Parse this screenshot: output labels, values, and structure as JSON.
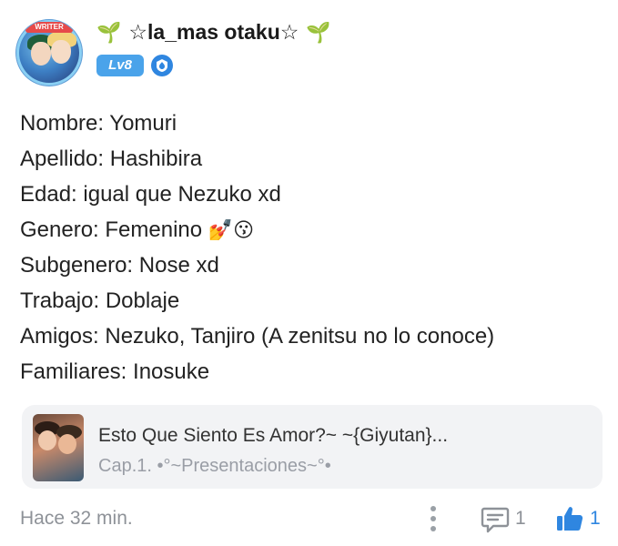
{
  "author": {
    "avatar_badge": "WRITER",
    "username": "☆la_mas otaku☆",
    "sprout_left": "🌱",
    "sprout_right": "🌱",
    "level": "Lv8",
    "level_color": "#4aa3ea",
    "leader_icon": "leader-shield-icon"
  },
  "post": {
    "lines": [
      "Nombre: Yomuri",
      "Apellido: Hashibira",
      "Edad: igual que Nezuko xd",
      "Genero: Femenino",
      "Subgenero: Nose xd",
      "Trabajo: Doblaje",
      "Amigos: Nezuko, Tanjiro (A zenitsu no lo conoce)",
      "Familiares: Inosuke"
    ],
    "genero_emojis": "💅😗"
  },
  "linked_story": {
    "title": "Esto Que Siento Es Amor?~ ~{Giyutan}...",
    "subtitle": "Cap.1. •°~Presentaciones~°•"
  },
  "footer": {
    "timestamp": "Hace 32 min.",
    "comment_count": "1",
    "like_count": "1",
    "like_color": "#2f86e0"
  }
}
